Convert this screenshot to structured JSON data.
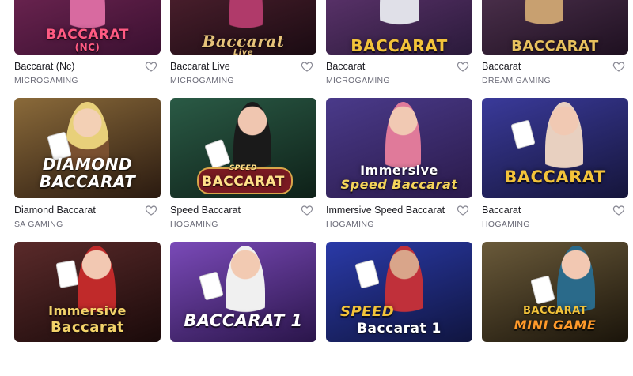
{
  "games": [
    {
      "name": "Baccarat (Nc)",
      "provider": "MICROGAMING",
      "art_line1": "BACCARAT",
      "art_line2": "(NC)",
      "bg": "#5b1f47",
      "accent": "#e64a6e"
    },
    {
      "name": "Baccarat Live",
      "provider": "MICROGAMING",
      "art_line1": "Baccarat",
      "art_line2": "Live",
      "bg": "#3a1a24",
      "accent": "#d8b25a"
    },
    {
      "name": "Baccarat",
      "provider": "MICROGAMING",
      "art_line1": "BACCARAT",
      "art_line2": "",
      "bg": "#4a2a5c",
      "accent": "#f3c33a"
    },
    {
      "name": "Baccarat",
      "provider": "DREAM GAMING",
      "art_line1": "BACCARAT",
      "art_line2": "",
      "bg": "#3b2540",
      "accent": "#e0b95a"
    },
    {
      "name": "Diamond Baccarat",
      "provider": "SA GAMING",
      "art_line1": "DIAMOND",
      "art_line2": "BACCARAT",
      "bg": "#6b4a2a",
      "accent": "#ffffff"
    },
    {
      "name": "Speed Baccarat",
      "provider": "HOGAMING",
      "art_line1": "SPEED",
      "art_line2": "BACCARAT",
      "bg": "#1f3a30",
      "accent": "#d9a64a"
    },
    {
      "name": "Immersive Speed Baccarat",
      "provider": "HOGAMING",
      "art_line1": "Immersive",
      "art_line2": "Speed Baccarat",
      "bg": "#3b2a6a",
      "accent": "#f4d45a"
    },
    {
      "name": "Baccarat",
      "provider": "HOGAMING",
      "art_line1": "BACCARAT",
      "art_line2": "",
      "bg": "#2a2a6a",
      "accent": "#f3c33a"
    },
    {
      "name": "",
      "provider": "",
      "art_line1": "Immersive",
      "art_line2": "Baccarat",
      "bg": "#3a1a1a",
      "accent": "#f3d36a"
    },
    {
      "name": "",
      "provider": "",
      "art_line1": "BACCARAT 1",
      "art_line2": "",
      "bg": "#4a2a8a",
      "accent": "#ffffff"
    },
    {
      "name": "",
      "provider": "",
      "art_line1": "SPEED",
      "art_line2": "Baccarat 1",
      "bg": "#1f2a7a",
      "accent": "#f3c33a"
    },
    {
      "name": "",
      "provider": "",
      "art_line1": "BACCARAT",
      "art_line2": "MINI GAME",
      "bg": "#3a2a1a",
      "accent": "#f3c33a"
    }
  ],
  "icons": {
    "favorite": "heart-outline-icon"
  }
}
